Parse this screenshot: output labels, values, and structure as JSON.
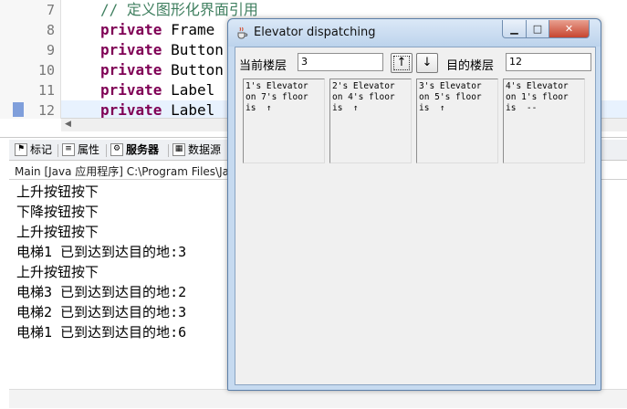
{
  "editor": {
    "line_numbers": [
      "7",
      "8",
      "9",
      "10",
      "11",
      "12"
    ],
    "comment": "// 定义图形化界面引用",
    "keyword": "private",
    "types": [
      "Frame",
      "Button",
      "Button",
      "Label",
      "Label"
    ]
  },
  "console": {
    "tabs": [
      {
        "label": "标记",
        "icon": "markers-icon"
      },
      {
        "label": "属性",
        "icon": "properties-icon"
      },
      {
        "label": "服务器",
        "icon": "servers-icon"
      },
      {
        "label": "数据源",
        "icon": "datasource-icon"
      }
    ],
    "title": "Main [Java 应用程序] C:\\Program Files\\Ja",
    "lines": [
      "上升按钮按下",
      "下降按钮按下",
      "上升按钮按下",
      "电梯1 已到达到达目的地:3",
      "上升按钮按下",
      "电梯3 已到达到达目的地:2",
      "电梯2 已到达到达目的地:3",
      "电梯1 已到达到达目的地:6"
    ]
  },
  "window": {
    "title": "Elevator dispatching",
    "current_floor_label": "当前楼层",
    "current_floor_value": "3",
    "up_button": "↑",
    "down_button": "↓",
    "target_floor_label": "目的楼层",
    "target_floor_value": "12",
    "elevators": [
      {
        "text": "1's Elevator\non 7's floor\nis  ↑"
      },
      {
        "text": "2's Elevator\non 4's floor\nis  ↑"
      },
      {
        "text": "3's Elevator\non 5's floor\nis  ↑"
      },
      {
        "text": "4's Elevator\non 1's floor\nis  --"
      }
    ]
  },
  "colors": {
    "keyword": "#7f0055",
    "comment": "#3f7f5f",
    "window_frame": "#c6daf0",
    "close_button": "#c6452f"
  }
}
